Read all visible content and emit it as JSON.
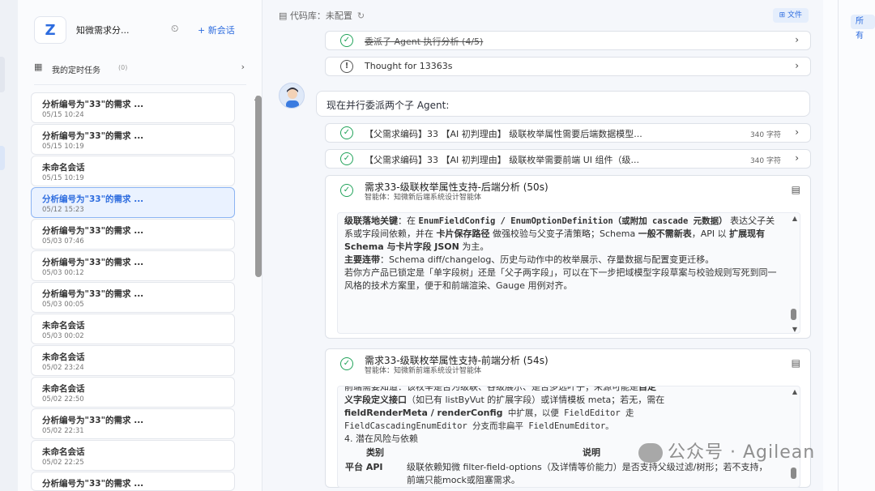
{
  "sidebar": {
    "logo": "Z",
    "title": "知微需求分...",
    "new_chat": "+ 新会话",
    "schedule": {
      "label": "我的定时任务",
      "count": "(0)"
    },
    "items": [
      {
        "title": "分析编号为\"33\"的需求 ...",
        "date": "05/15 10:24"
      },
      {
        "title": "分析编号为\"33\"的需求 ...",
        "date": "05/15 10:19"
      },
      {
        "title": "未命名会话",
        "date": "05/15 10:19"
      },
      {
        "title": "分析编号为\"33\"的需求 ...",
        "date": "05/12 15:23"
      },
      {
        "title": "分析编号为\"33\"的需求 ...",
        "date": "05/03 07:46"
      },
      {
        "title": "分析编号为\"33\"的需求 ...",
        "date": "05/03 00:12"
      },
      {
        "title": "分析编号为\"33\"的需求 ...",
        "date": "05/03 00:05"
      },
      {
        "title": "未命名会话",
        "date": "05/03 00:02"
      },
      {
        "title": "未命名会话",
        "date": "05/02 23:24"
      },
      {
        "title": "未命名会话",
        "date": "05/02 22:50"
      },
      {
        "title": "分析编号为\"33\"的需求 ...",
        "date": "05/02 22:31"
      },
      {
        "title": "未命名会话",
        "date": "05/02 22:25"
      },
      {
        "title": "分析编号为\"33\"的需求 ...",
        "date": ""
      }
    ]
  },
  "main": {
    "repo": "代码库：未配置",
    "file_button": "文件",
    "delegated_row": "委派子 Agent 执行分析 (4/5)",
    "thought_row": "Thought for 13363s",
    "user_message": "现在并行委派两个子 Agent:",
    "task_rows": [
      {
        "label": "【父需求编码】33 【AI 初判理由】 级联枚举属性需要后端数据模型...",
        "chars": "340 字符"
      },
      {
        "label": "【父需求编码】33 【AI 初判理由】 级联枚举需要前端 UI 组件（级...",
        "chars": "340 字符"
      }
    ],
    "card1": {
      "title": "需求33-级联枚举属性支持-后端分析 (50s)",
      "agent": "智能体：知微新后端系统设计智能体",
      "p1_label": "级联落地关键",
      "p1_a": "：在 ",
      "p1_code": "EnumFieldConfig / EnumOptionDefinition（或附加 cascade 元数据）",
      "p1_b": "表达父子关系或字段间依赖，并在 ",
      "p1_bold2": "卡片保存路径",
      "p1_c": " 做强校验与父变子清策略；Schema ",
      "p1_bold3": "一般不需新表",
      "p1_d": "，API 以 ",
      "p1_bold4": "扩展现有 Schema 与卡片字段 JSON",
      "p1_e": " 为主。",
      "p2_label": "主要连带",
      "p2_text": "：Schema diff/changelog、历史与动作中的枚举展示、存量数据与配置变更迁移。",
      "p3_text": "若你方产品已锁定是「单字段树」还是「父子两字段」，可以在下一步把域模型字段草案与校验规则写死到同一风格的技术方案里，便于和前端渲染、Gauge 用例对齐。"
    },
    "card2": {
      "title": "需求33-级联枚举属性支持-前端分析 (54s)",
      "agent": "智能体：知微新前端系统设计智能体",
      "l0": "前端需要知道：该枚举是否为级联、各级展示、是否多选叶子；来源可能是",
      "l0_bold": "自定",
      "l1_bold": "义字段定义接口",
      "l1": "（如已有 listByVut 的扩展字段）或详情模板 meta；若无，需在",
      "l2_bold": "fieldRenderMeta / renderConfig",
      "l2": " 中扩展，以便 FieldEditor 走",
      "l3": "FieldCascadingEnumEditor 分支而非扁平 FieldEnumEditor。",
      "section": "4. 潜在风险与依赖",
      "th1": "类别",
      "th2": "说明",
      "td1": "平台 API",
      "td2": "级联依赖知微 filter-field-options（及详情等价能力）是否支持父级过滤/树形；若不支持，前端只能mock或阻塞需求。"
    }
  },
  "right_panel": {
    "all_button": "所有"
  },
  "watermark": "公众号 · Agilean"
}
